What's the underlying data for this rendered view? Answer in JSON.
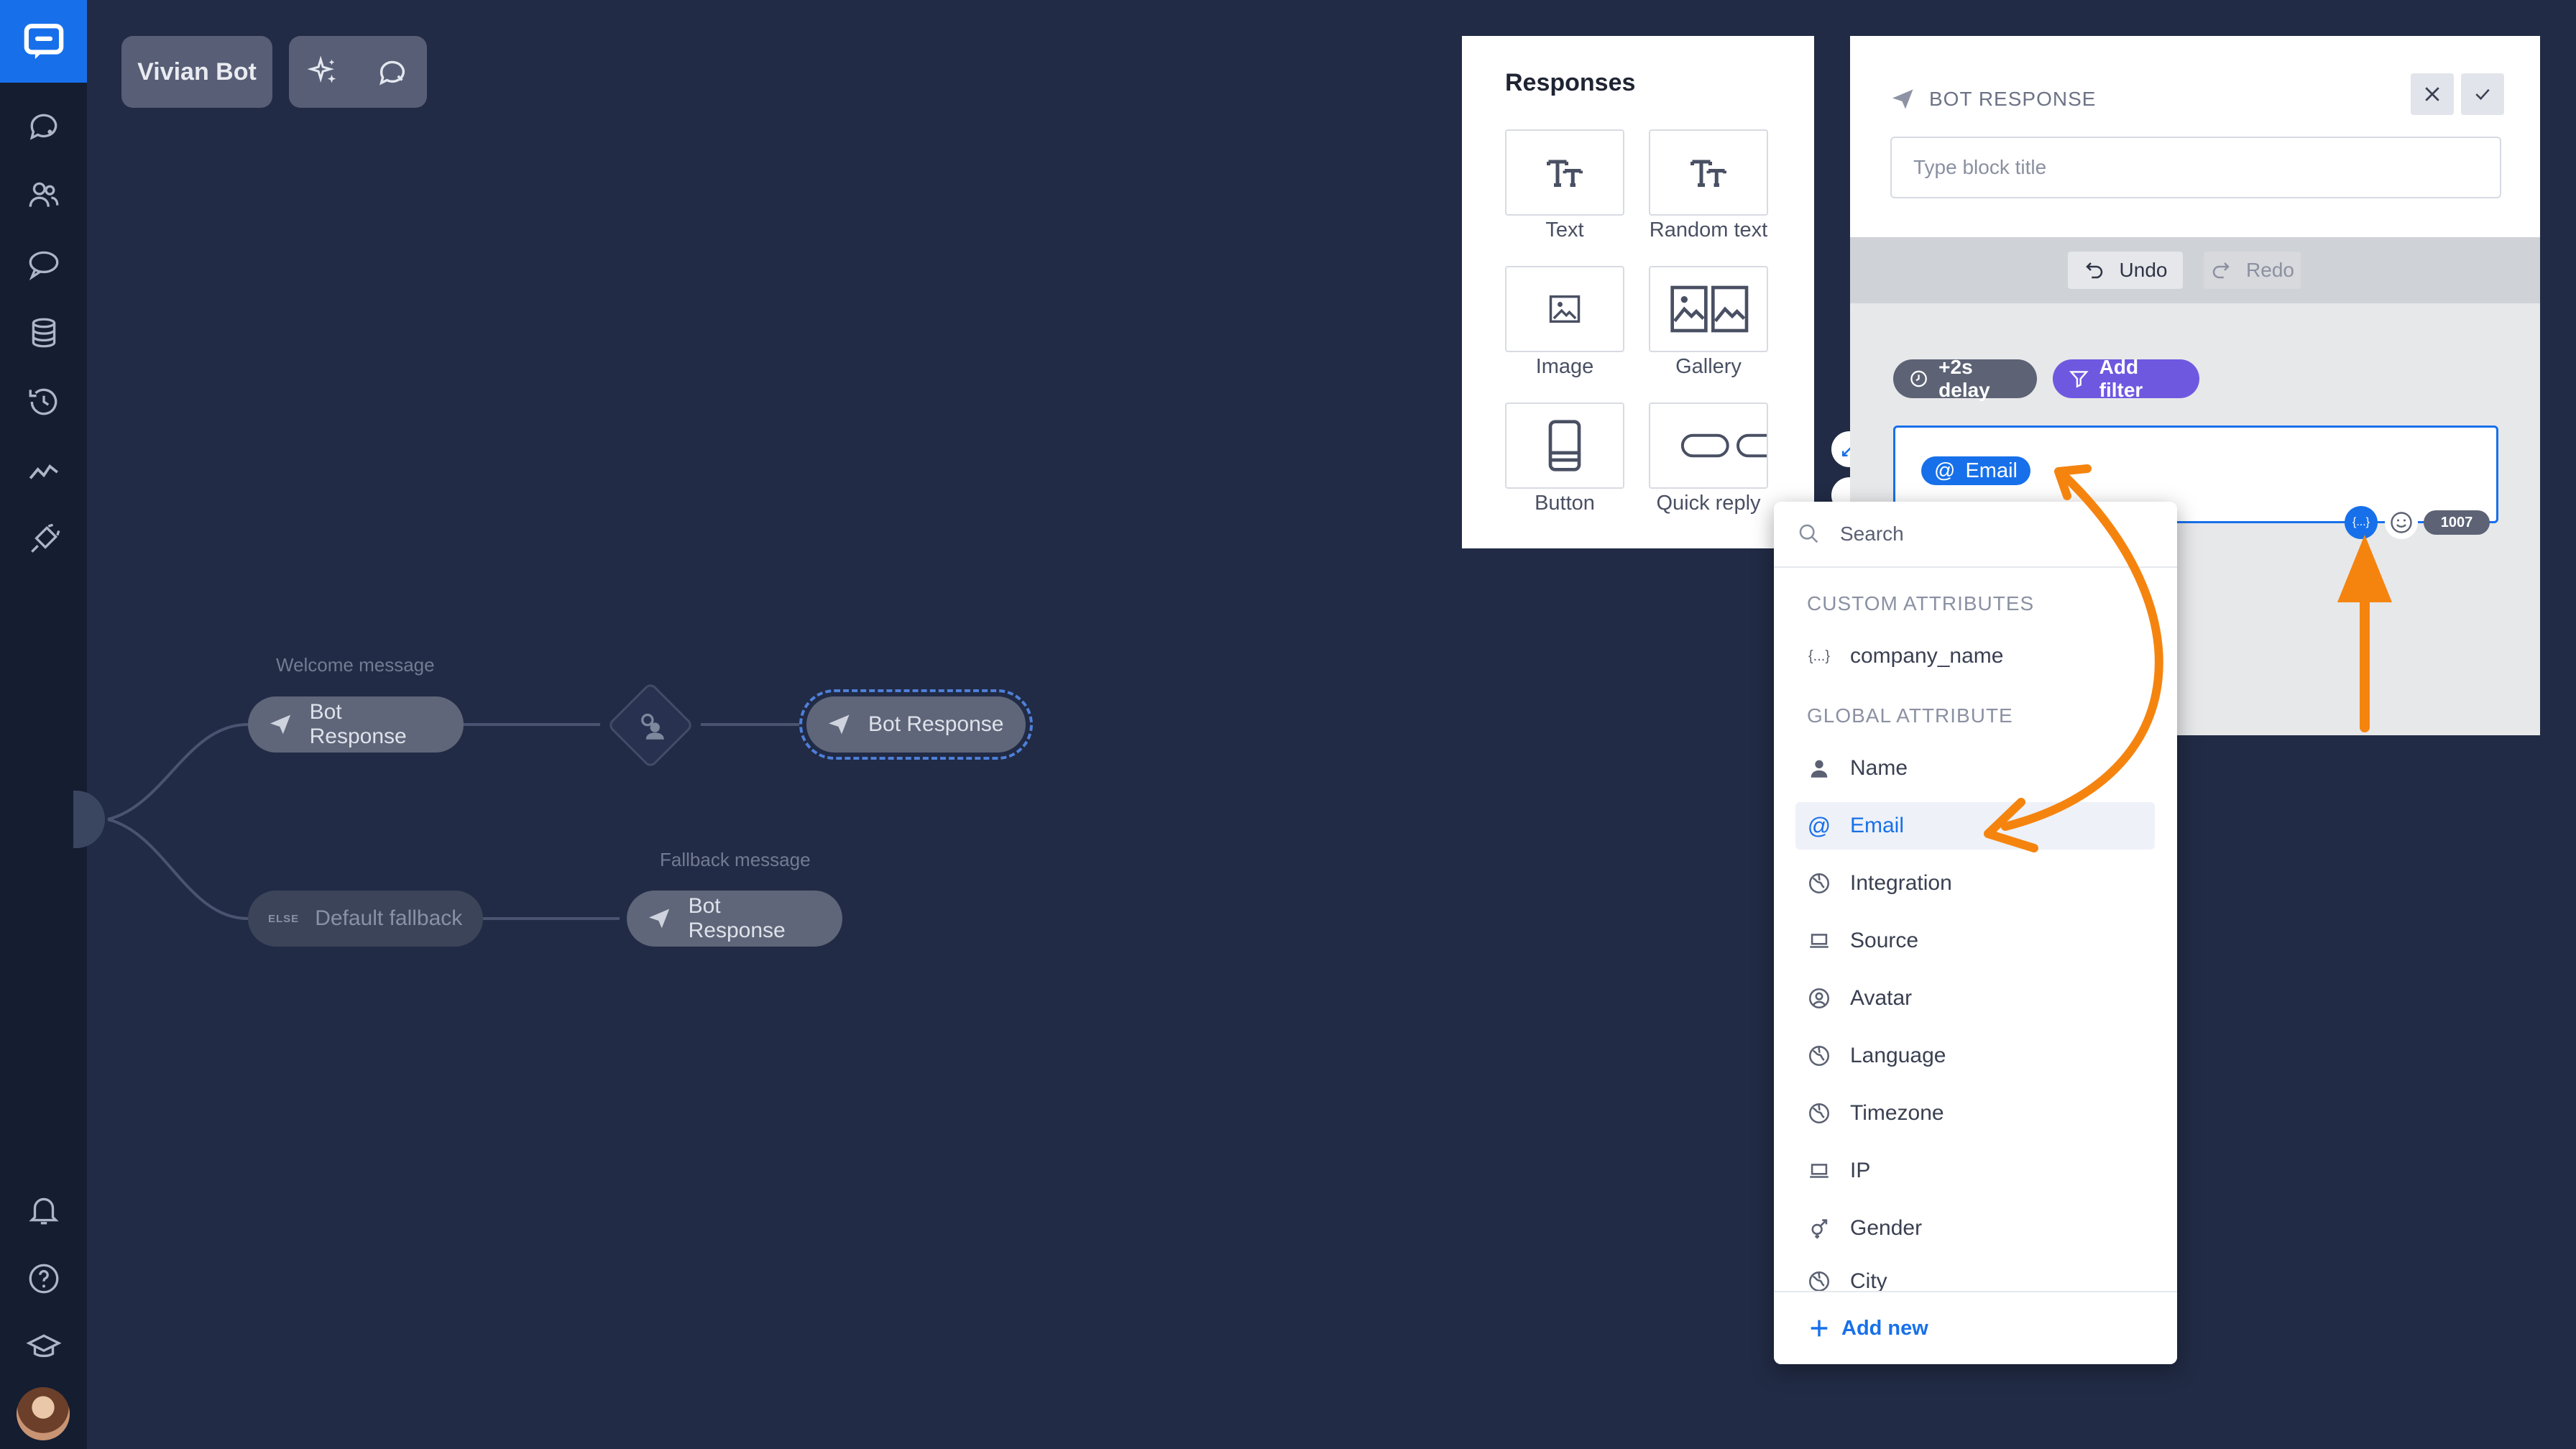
{
  "app": {
    "bot_name": "Vivian Bot"
  },
  "sidebar": {
    "icons": [
      "chats-icon",
      "customers-icon",
      "conversations-icon",
      "database-icon",
      "history-icon",
      "reports-icon",
      "integrations-icon",
      "notifications-icon",
      "help-icon",
      "academy-icon"
    ]
  },
  "flow": {
    "welcome_label": "Welcome message",
    "fallback_label": "Fallback message",
    "node_bot_response_1": "Bot Response",
    "node_bot_response_2": "Bot Response",
    "node_bot_response_3": "Bot Response",
    "node_default_fallback": "Default fallback",
    "else_tag": "ELSE"
  },
  "responses": {
    "title": "Responses",
    "items": [
      {
        "label": "Text",
        "icon": "text-icon"
      },
      {
        "label": "Random text",
        "icon": "random-text-icon"
      },
      {
        "label": "Image",
        "icon": "image-icon"
      },
      {
        "label": "Gallery",
        "icon": "gallery-icon"
      },
      {
        "label": "Button",
        "icon": "button-icon"
      },
      {
        "label": "Quick reply",
        "icon": "quick-reply-icon"
      }
    ]
  },
  "editor": {
    "header": "BOT RESPONSE",
    "title_placeholder": "Type block title",
    "undo": "Undo",
    "redo": "Redo",
    "delay": "+2s delay",
    "add_filter": "Add filter",
    "email_tag": "Email",
    "char_count": "1007",
    "attr_button": "{...}"
  },
  "dropdown": {
    "search_placeholder": "Search",
    "custom_section": "CUSTOM ATTRIBUTES",
    "custom_items": [
      {
        "label": "company_name",
        "icon": "braces-icon"
      }
    ],
    "global_section": "GLOBAL ATTRIBUTE",
    "global_items": [
      {
        "label": "Name",
        "icon": "person-icon"
      },
      {
        "label": "Email",
        "icon": "at-icon",
        "active": true
      },
      {
        "label": "Integration",
        "icon": "globe-icon"
      },
      {
        "label": "Source",
        "icon": "laptop-icon"
      },
      {
        "label": "Avatar",
        "icon": "avatar-icon"
      },
      {
        "label": "Language",
        "icon": "globe-icon"
      },
      {
        "label": "Timezone",
        "icon": "globe-icon"
      },
      {
        "label": "IP",
        "icon": "laptop-icon"
      },
      {
        "label": "Gender",
        "icon": "gender-icon"
      },
      {
        "label": "City",
        "icon": "globe-icon"
      }
    ],
    "add_new": "Add new"
  },
  "colors": {
    "canvas": "#212b45",
    "sidebar": "#151d30",
    "accent": "#1770ea",
    "annotation_arrow": "#f5840f",
    "filter_pill": "#6f58e0"
  }
}
